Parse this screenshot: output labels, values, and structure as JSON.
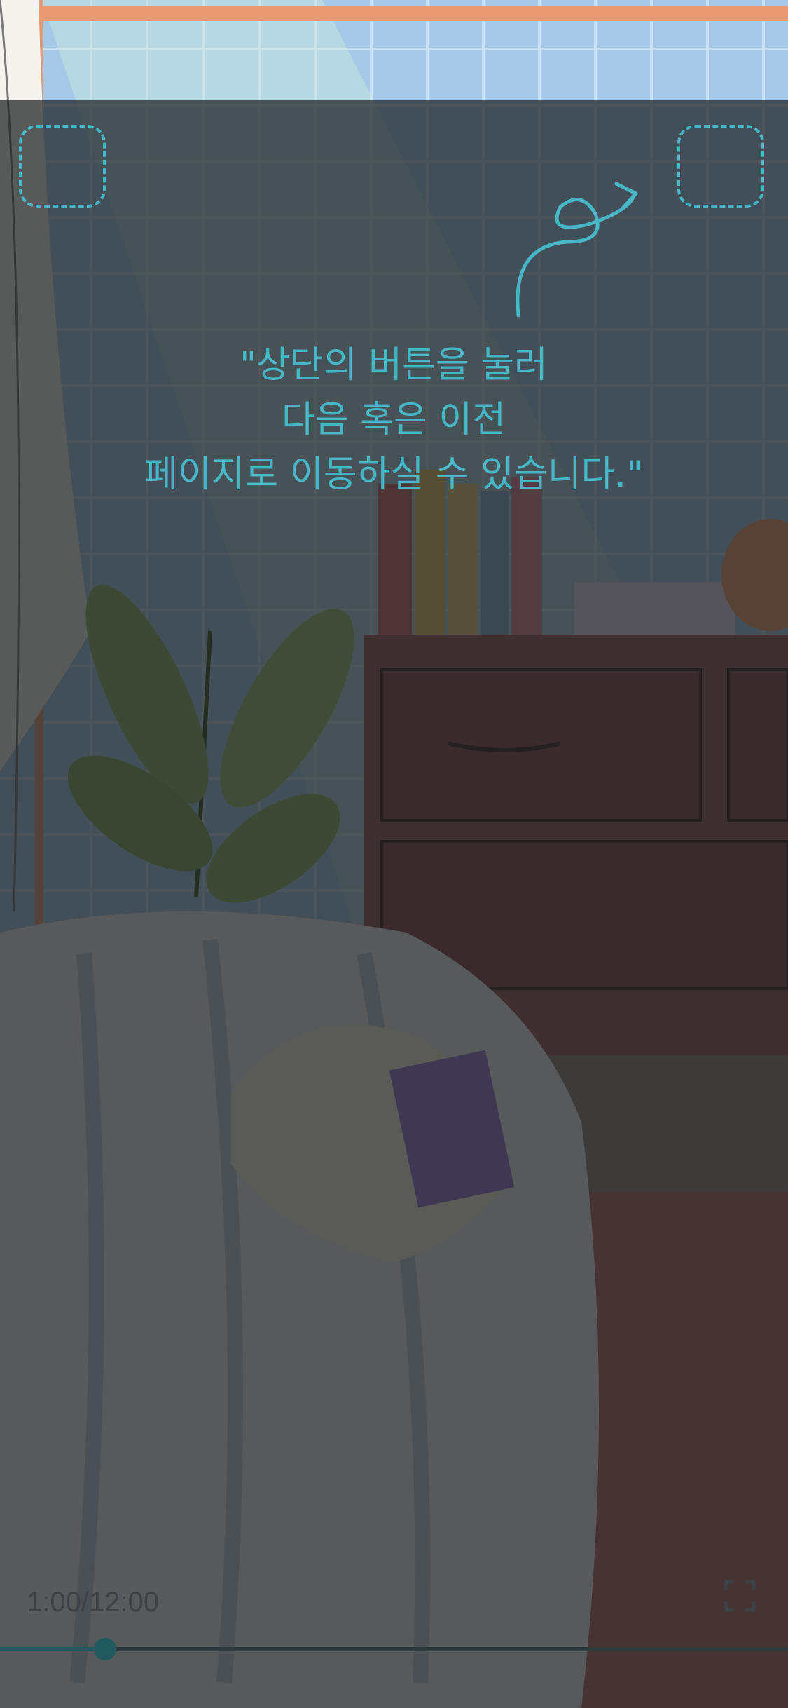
{
  "guide": {
    "line1": "\"상단의 버튼을 눌러",
    "line2": "다음 혹은 이전",
    "line3": "페이지로 이동하실 수 있습니다.\""
  },
  "buttons": {
    "prev_icon": "dashed-square-icon",
    "next_icon": "dashed-square-icon",
    "fullscreen_icon": "fullscreen-icon"
  },
  "player": {
    "time": "1:00/12:00",
    "progress": 0.133
  },
  "colors": {
    "accent": "#47b7c8",
    "overlay": "#1c1e20",
    "progress": "#1f5a5e"
  }
}
